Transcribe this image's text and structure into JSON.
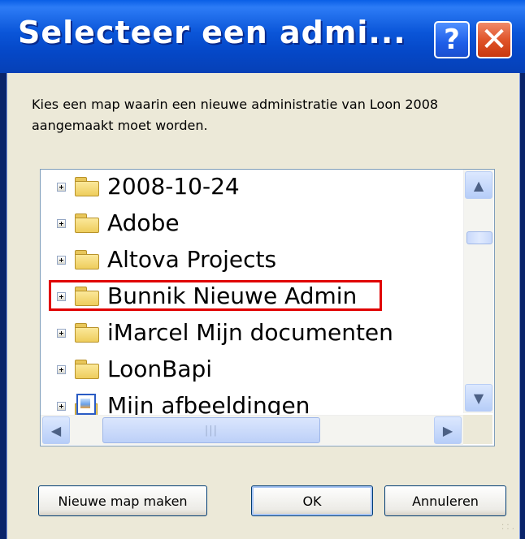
{
  "window": {
    "title": "Selecteer een admi...",
    "help_glyph": "?",
    "close_glyph": "✕"
  },
  "description": "Kies een map waarin een nieuwe administratie van Loon 2008 aangemaakt moet worden.",
  "folders": [
    {
      "label": "2008-10-24",
      "icon": "folder-icon"
    },
    {
      "label": "Adobe",
      "icon": "folder-icon"
    },
    {
      "label": "Altova Projects",
      "icon": "folder-icon"
    },
    {
      "label": "Bunnik Nieuwe Admin",
      "icon": "folder-icon",
      "highlighted": true
    },
    {
      "label": "iMarcel Mijn documenten",
      "icon": "folder-icon"
    },
    {
      "label": "LoonBapi",
      "icon": "folder-icon"
    },
    {
      "label": "Mijn afbeeldingen",
      "icon": "pictures-folder-icon"
    }
  ],
  "scrollbar": {
    "up": "▲",
    "down": "▼",
    "left": "◀",
    "right": "▶",
    "grip": "|||"
  },
  "buttons": {
    "new_folder": "Nieuwe map maken",
    "ok": "OK",
    "cancel": "Annuleren"
  },
  "colors": {
    "titlebar": "#0548c8",
    "highlight_border": "#e00000",
    "dialog_bg": "#ece9d8"
  }
}
